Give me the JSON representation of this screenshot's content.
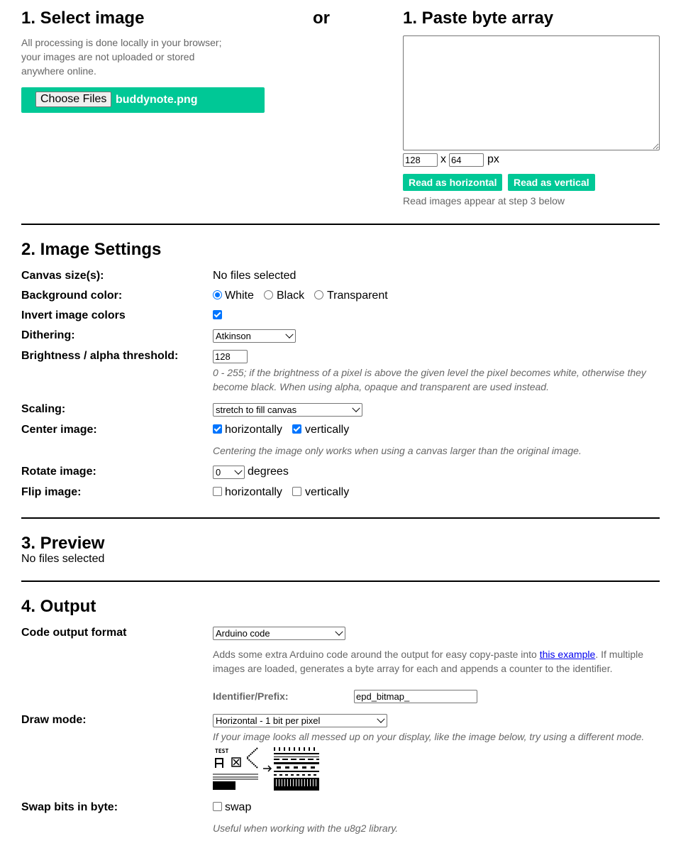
{
  "step1": {
    "select_title": "1. Select image",
    "or_label": "or",
    "paste_title": "1. Paste byte array",
    "privacy_note": [
      "All processing is done locally in your browser;",
      "your images are not uploaded or stored",
      "anywhere online."
    ],
    "choose_files_label": "Choose Files",
    "selected_file": "buddynote.png",
    "byte_array_value": "",
    "width_value": "128",
    "x_label": "x",
    "height_value": "64",
    "px_label": "px",
    "read_horizontal_label": "Read as horizontal",
    "read_vertical_label": "Read as vertical",
    "read_note": "Read images appear at step 3 below"
  },
  "settings": {
    "title": "2. Image Settings",
    "canvas_size_label": "Canvas size(s):",
    "canvas_size_value": "No files selected",
    "background_label": "Background color:",
    "bg_options": [
      "White",
      "Black",
      "Transparent"
    ],
    "bg_selected": "White",
    "invert_label": "Invert image colors",
    "invert_checked": true,
    "dithering_label": "Dithering:",
    "dithering_value": "Atkinson",
    "brightness_label": "Brightness / alpha threshold:",
    "brightness_value": "128",
    "brightness_hint": [
      "0 - 255; if the brightness of a pixel is above the given level the pixel becomes white, otherwise they",
      "become black. When using alpha, opaque and transparent are used instead."
    ],
    "scaling_label": "Scaling:",
    "scaling_value": "stretch to fill canvas",
    "center_label": "Center image:",
    "center_h_label": "horizontally",
    "center_v_label": "vertically",
    "center_h_checked": true,
    "center_v_checked": true,
    "center_hint": "Centering the image only works when using a canvas larger than the original image.",
    "rotate_label": "Rotate image:",
    "rotate_value": "0",
    "degrees_label": "degrees",
    "flip_label": "Flip image:",
    "flip_h_label": "horizontally",
    "flip_v_label": "vertically"
  },
  "preview": {
    "title": "3. Preview",
    "status": "No files selected"
  },
  "output": {
    "title": "4. Output",
    "format_label": "Code output format",
    "format_value": "Arduino code",
    "format_hint_1": "Adds some extra Arduino code around the output for easy copy-paste into ",
    "format_hint_link": "this example",
    "format_hint_2": ". If multiple",
    "format_hint_3": "images are loaded, generates a byte array for each and appends a counter to the identifier.",
    "identifier_label": "Identifier/Prefix:",
    "identifier_value": "epd_bitmap_",
    "draw_mode_label": "Draw mode:",
    "draw_mode_value": "Horizontal - 1 bit per pixel",
    "draw_mode_hint": "If your image looks all messed up on your display, like the image below, try using a different mode.",
    "example_text": "TEST",
    "swap_label": "Swap bits in byte:",
    "swap_option": "swap",
    "swap_hint": "Useful when working with the u8g2 library."
  }
}
